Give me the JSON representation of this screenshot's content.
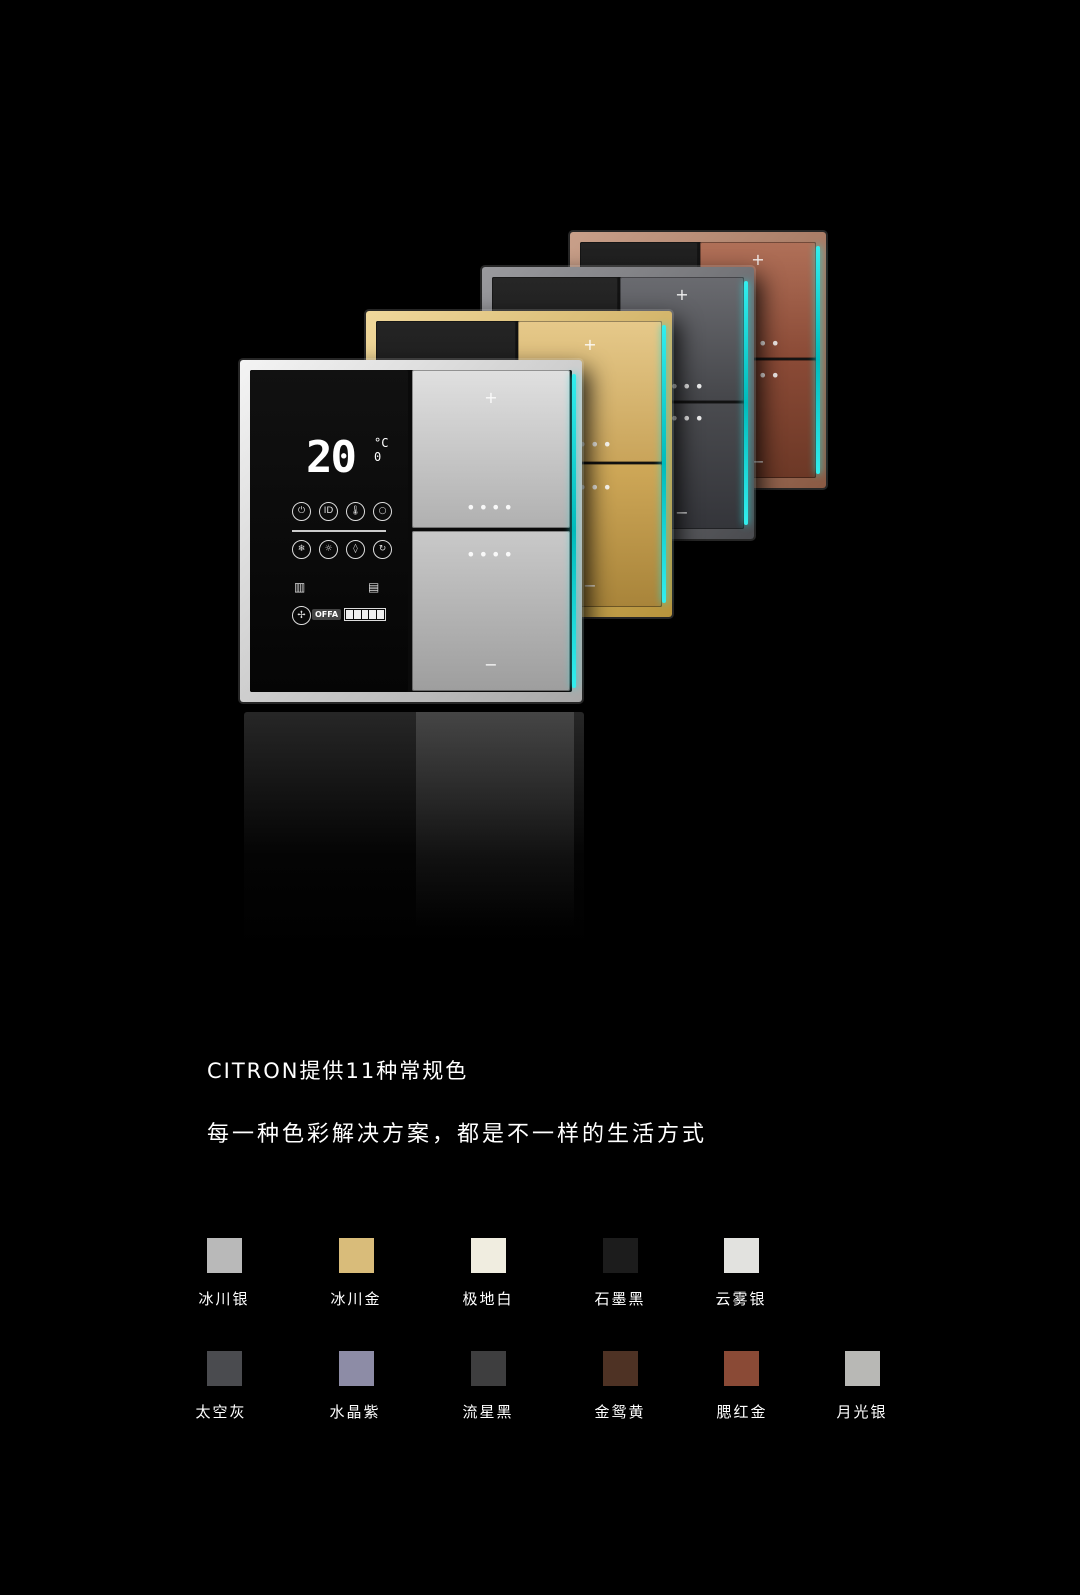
{
  "product": {
    "lcd": {
      "temperature": "20",
      "unit_top": "°C",
      "unit_bottom": "0",
      "fan_label": "OFFA"
    },
    "key_plus": "+",
    "key_minus": "−",
    "key_dots": "••••"
  },
  "headline": "CITRON提供11种常规色",
  "subline": "每一种色彩解决方案，都是不一样的生活方式",
  "colors": [
    {
      "name": "冰川银",
      "hex": "#b9b9b9"
    },
    {
      "name": "冰川金",
      "hex": "#d9bc7a"
    },
    {
      "name": "极地白",
      "hex": "#f0ede0"
    },
    {
      "name": "石墨黑",
      "hex": "#1c1c1c"
    },
    {
      "name": "云雾银",
      "hex": "#e2e2df"
    },
    {
      "name": "太空灰",
      "hex": "#4a4b4f"
    },
    {
      "name": "水晶紫",
      "hex": "#8d8ca6"
    },
    {
      "name": "流星黑",
      "hex": "#3e3e3f"
    },
    {
      "name": "金鸳黄",
      "hex": "#4e3224"
    },
    {
      "name": "腮红金",
      "hex": "#8a4a36"
    },
    {
      "name": "月光银",
      "hex": "#b8b8b5"
    }
  ]
}
